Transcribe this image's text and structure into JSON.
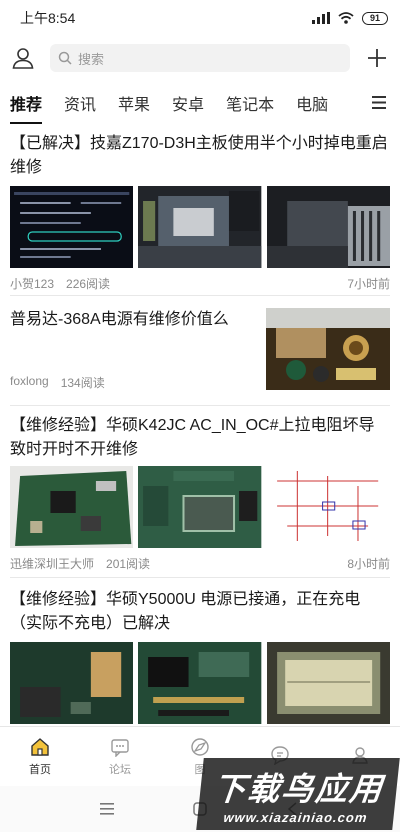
{
  "status": {
    "time": "上午8:54",
    "battery": "91"
  },
  "search": {
    "placeholder": "搜索"
  },
  "tabs": [
    {
      "label": "推荐",
      "active": true
    },
    {
      "label": "资讯"
    },
    {
      "label": "苹果"
    },
    {
      "label": "安卓"
    },
    {
      "label": "笔记本"
    },
    {
      "label": "电脑"
    }
  ],
  "articles": [
    {
      "title": "【已解决】技嘉Z170-D3H主板使用半个小时掉电重启维修",
      "author": "小贺123",
      "reads": "226阅读",
      "time": "7小时前",
      "images": 3
    },
    {
      "title": "普易达-368A电源有维修价值么",
      "author": "foxlong",
      "reads": "134阅读",
      "time": "",
      "images": 1
    },
    {
      "title": "【维修经验】华硕K42JC AC_IN_OC#上拉电阻坏导致时开时不开维修",
      "author": "迅维深圳王大师",
      "reads": "201阅读",
      "time": "8小时前",
      "images": 3
    },
    {
      "title": "【维修经验】华硕Y5000U 电源已接通，正在充电（实际不充电）已解决",
      "author": "",
      "reads": "",
      "time": "",
      "images": 3
    }
  ],
  "nav": [
    {
      "label": "首页",
      "icon": "home-icon",
      "active": true
    },
    {
      "label": "论坛",
      "icon": "forum-icon"
    },
    {
      "label": "图",
      "icon": "image-icon"
    },
    {
      "label": "",
      "icon": "chat-icon"
    },
    {
      "label": "",
      "icon": "user-icon"
    }
  ],
  "watermark": {
    "main": "下载鸟应用",
    "sub": "www.xiazainiao.com"
  }
}
